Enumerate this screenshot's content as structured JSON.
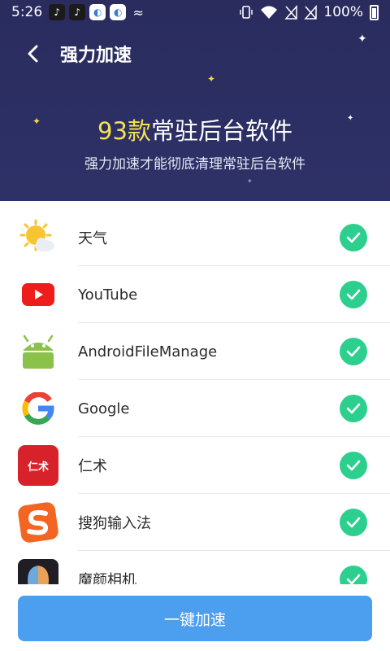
{
  "status_bar": {
    "time": "5:26",
    "battery": "100%",
    "notification_icons": [
      "tiktok-icon",
      "tiktok-icon",
      "browser-icon",
      "browser-icon",
      "bird-icon"
    ],
    "status_icons": [
      "vibrate-icon",
      "wifi-icon",
      "no-sim-icon",
      "no-sim-icon",
      "battery-icon"
    ]
  },
  "header": {
    "title": "强力加速",
    "headline_count": "93款",
    "headline_rest": "常驻后台软件",
    "subtitle": "强力加速才能彻底清理常驻后台软件"
  },
  "apps": [
    {
      "name": "天气",
      "icon": "weather-icon",
      "checked": true
    },
    {
      "name": "YouTube",
      "icon": "youtube-icon",
      "checked": true
    },
    {
      "name": "AndroidFileManage",
      "icon": "android-icon",
      "checked": true
    },
    {
      "name": "Google",
      "icon": "google-icon",
      "checked": true
    },
    {
      "name": "仁术",
      "icon": "renshu-icon",
      "icon_text": "仁术",
      "checked": true
    },
    {
      "name": "搜狗输入法",
      "icon": "sogou-icon",
      "checked": true
    },
    {
      "name": "魔颜相机",
      "icon": "camera-icon",
      "checked": true
    }
  ],
  "action": {
    "label": "一键加速"
  },
  "colors": {
    "header_bg": "#2c2f60",
    "highlight": "#f7e250",
    "check": "#2dcf8f",
    "button": "#4c9eee"
  }
}
